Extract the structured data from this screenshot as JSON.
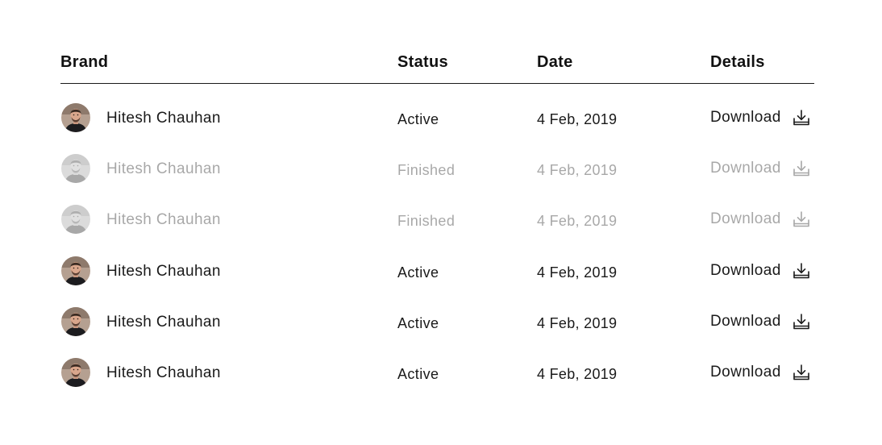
{
  "table": {
    "headers": {
      "brand": "Brand",
      "status": "Status",
      "date": "Date",
      "details": "Details"
    },
    "rows": [
      {
        "brand": "Hitesh Chauhan",
        "status": "Active",
        "date": "4 Feb, 2019",
        "details": "Download",
        "state": "active"
      },
      {
        "brand": "Hitesh Chauhan",
        "status": "Finished",
        "date": "4 Feb, 2019",
        "details": "Download",
        "state": "finished"
      },
      {
        "brand": "Hitesh Chauhan",
        "status": "Finished",
        "date": "4 Feb, 2019",
        "details": "Download",
        "state": "finished"
      },
      {
        "brand": "Hitesh Chauhan",
        "status": "Active",
        "date": "4 Feb, 2019",
        "details": "Download",
        "state": "active"
      },
      {
        "brand": "Hitesh Chauhan",
        "status": "Active",
        "date": "4 Feb, 2019",
        "details": "Download",
        "state": "active"
      },
      {
        "brand": "Hitesh Chauhan",
        "status": "Active",
        "date": "4 Feb, 2019",
        "details": "Download",
        "state": "active"
      }
    ]
  },
  "icons": {
    "avatar": "avatar-photo",
    "download": "download-icon"
  },
  "colors": {
    "text": "#1a1a1a",
    "divider": "#1a1a1a",
    "background": "#ffffff"
  }
}
